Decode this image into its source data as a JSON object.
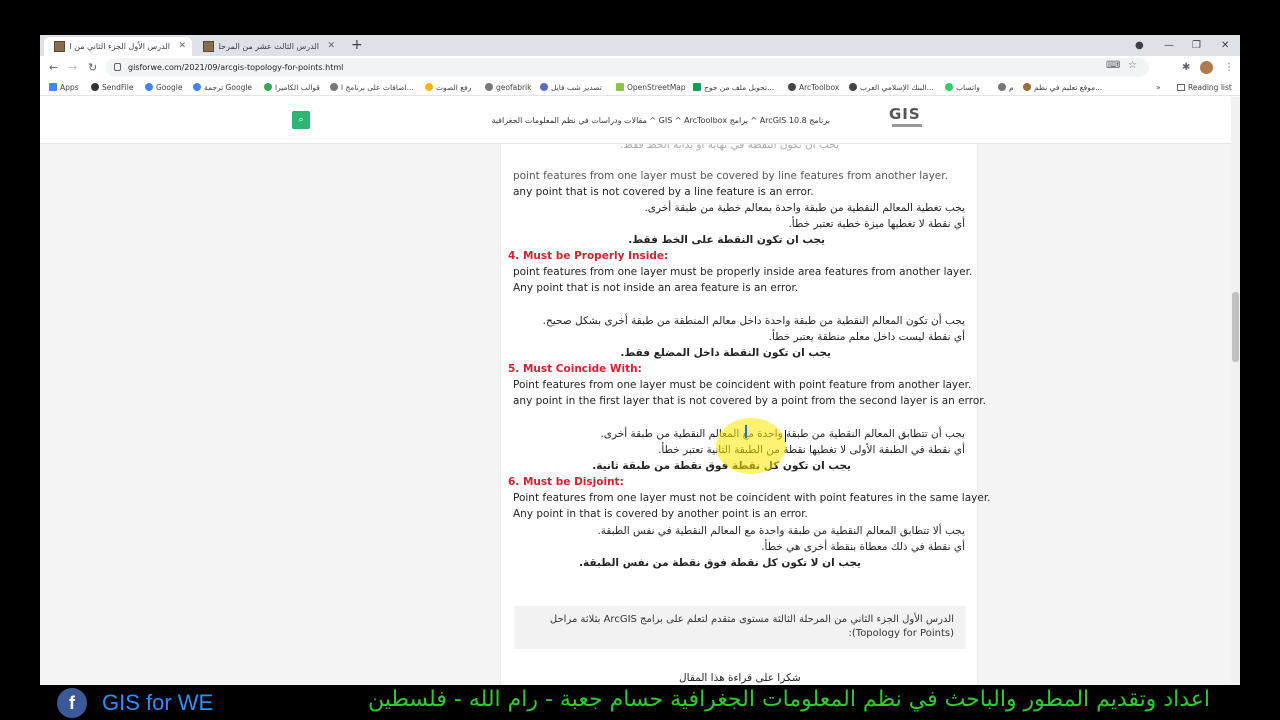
{
  "browser": {
    "tabs": [
      {
        "title": "الدرس الأول الجزء الثاني من المرحلة...",
        "active": true
      },
      {
        "title": "الدرس الثالث عشر من المرحلة الأو...",
        "active": false
      }
    ],
    "url": "gisforwe.com/2021/09/arcgis-topology-for-points.html",
    "bookmarks": [
      "Apps",
      "SendFile",
      "Google",
      "ترجمة Google",
      "قوالب الكاميرا",
      "اضافات على برنامج ا...",
      "رفع الصوت",
      "geofabrik",
      "تصدير شب فايل",
      "OpenStreetMap",
      "تحويل ملف من جوج...",
      "ArcToolbox",
      "البنك الإسلامي العرب...",
      "واتساب",
      "م",
      "موقع تعليم في نظم..."
    ],
    "reading_list": "Reading list"
  },
  "site": {
    "nav": "برنامج ArcGIS 10.8 ^ برامج GIS ^ ArcToolbox ^ مقالات ودراسات في نظم المعلومات الجغرافية",
    "logo": "GIS"
  },
  "article": {
    "faded_line": "يجب ان تكون النقطة في نهاية او بداية الخط فقط.",
    "s3_en1": "point features from one layer must be covered by line features from another layer.",
    "s3_en2": "any point that is not covered by a line feature is an error.",
    "s3_ar1": "يجب تغطية المعالم النقطية من طبقة واحدة بمعالم خطية من طبقة أخرى.",
    "s3_ar2": "أي نقطة لا تغطيها ميزة خطية تعتبر خطأ.",
    "s3_ar3": "يجب ان تكون النقطة على الخط فقط.",
    "s4_title": "4. Must be Properly Inside:",
    "s4_en1": "point features from one layer must be properly inside area features from another layer.",
    "s4_en2": "Any point that is not inside an area feature is an error.",
    "s4_ar1": "يجب أن تكون المعالم النقطية من طبقة واحدة داخل معالم المنطقة من طبقة أخرى بشكل صحيح.",
    "s4_ar2": "أي نقطة ليست داخل معلم منطقة يعتبر خطأ.",
    "s4_ar3": "يجب ان تكون النقطة داخل المضلع فقط.",
    "s5_title": "5.  Must Coincide With:",
    "s5_en1": "Point features from one layer must be coincident with point feature from another layer.",
    "s5_en2": "any point in the first layer that is not covered by a point from the second layer is an error.",
    "s5_ar1": "يجب أن تتطابق المعالم النقطية من طبقة واحدة مع المعالم النقطية من طبقة أخرى.",
    "s5_ar2": "أي نقطة في الطبقة الأولى لا تغطيها نقطة من الطبقة الثانية تعتبر خطأ.",
    "s5_ar3": "يجب ان تكون كل نقطة فوق نقطة من طبقة ثانية.",
    "s6_title": "6. Must be Disjoint:",
    "s6_en1": "Point features from one layer must not be coincident with point features in the same layer.",
    "s6_en2": "Any point in that is covered by another point is an error.",
    "s6_ar1": "يجب ألا تتطابق المعالم النقطية من طبقة واحدة مع المعالم النقطية في نفس الطبقة.",
    "s6_ar2": "أي نقطة في ذلك معطاة بنقطة أخرى هي خطأ.",
    "s6_ar3": "يجب ان لا تكون كل نقطة فوق نقطة من نفس الطبقة.",
    "note_line1": "الدرس الأول الجزء الثاني من المرحلة الثالثة مستوى متقدم لتعلم على برامج ArcGIS  بثلاثة مراحل",
    "note_line2": "(Topology for Points):",
    "thanks": "شكرا على قراءة هذا المقال"
  },
  "caption": {
    "brand": "GIS for WE",
    "credit": "اعداد وتقديم المطور والباحث في نظم المعلومات الجغرافية حسام جعبة - رام الله - فلسطين"
  },
  "colors": {
    "heading": "#d6222a",
    "search_button": "#2bb673",
    "facebook": "#3b5998",
    "brand_text": "#2f8fff",
    "credit_text": "#2ecc2e"
  }
}
